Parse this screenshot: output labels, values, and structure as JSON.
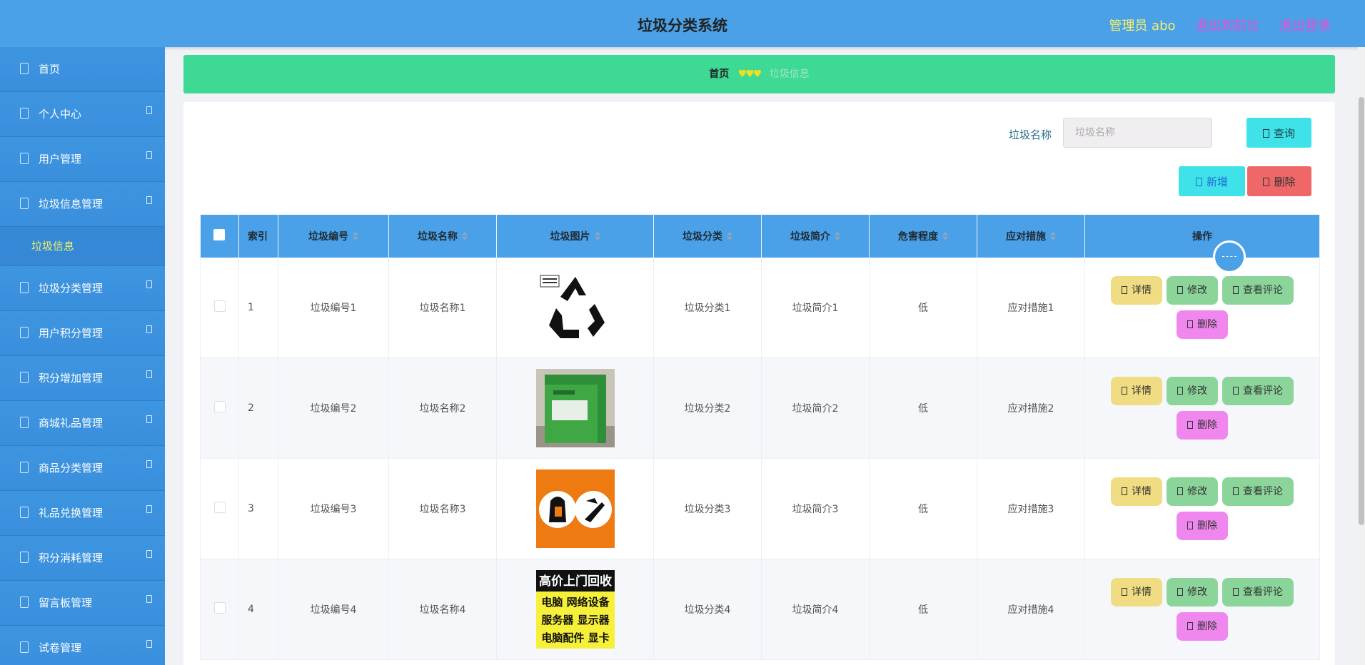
{
  "header": {
    "title": "垃圾分类系统",
    "user": "管理员 abo",
    "front": "退出到前台",
    "logout": "退出登录"
  },
  "sidebar": {
    "items": [
      {
        "label": "首页"
      },
      {
        "label": "个人中心"
      },
      {
        "label": "用户管理"
      },
      {
        "label": "垃圾信息管理"
      },
      {
        "label": "垃圾分类管理"
      },
      {
        "label": "用户积分管理"
      },
      {
        "label": "积分增加管理"
      },
      {
        "label": "商城礼品管理"
      },
      {
        "label": "商品分类管理"
      },
      {
        "label": "礼品兑换管理"
      },
      {
        "label": "积分消耗管理"
      },
      {
        "label": "留言板管理"
      },
      {
        "label": "试卷管理"
      }
    ],
    "submenu": "垃圾信息"
  },
  "breadcrumb": {
    "home": "首页",
    "sep": "♥♥♥",
    "current": "垃圾信息"
  },
  "search": {
    "label": "垃圾名称",
    "placeholder": "垃圾名称",
    "query": "查询"
  },
  "toolbar": {
    "add": "新增",
    "delete": "删除"
  },
  "table": {
    "headers": [
      "索引",
      "垃圾编号",
      "垃圾名称",
      "垃圾图片",
      "垃圾分类",
      "垃圾简介",
      "危害程度",
      "应对措施",
      "操作"
    ],
    "rows": [
      {
        "index": "1",
        "code": "垃圾编号1",
        "name": "垃圾名称1",
        "category": "垃圾分类1",
        "intro": "垃圾简介1",
        "harm": "低",
        "measure": "应对措施1",
        "image": "recycle-symbol"
      },
      {
        "index": "2",
        "code": "垃圾编号2",
        "name": "垃圾名称2",
        "category": "垃圾分类2",
        "intro": "垃圾简介2",
        "harm": "低",
        "measure": "应对措施2",
        "image": "green-bin-photo"
      },
      {
        "index": "3",
        "code": "垃圾编号3",
        "name": "垃圾名称3",
        "category": "垃圾分类3",
        "intro": "垃圾简介3",
        "harm": "低",
        "measure": "应对措施3",
        "image": "orange-sign"
      },
      {
        "index": "4",
        "code": "垃圾编号4",
        "name": "垃圾名称4",
        "category": "垃圾分类4",
        "intro": "垃圾简介4",
        "harm": "低",
        "measure": "应对措施4",
        "image": "recycle-poster",
        "image_text": [
          "高价上门回收",
          "电脑 网络设备",
          "服务器 显示器",
          "电脑配件 显卡"
        ]
      }
    ],
    "actions": {
      "detail": "详情",
      "edit": "修改",
      "comment": "查看评论",
      "delete": "删除"
    }
  }
}
